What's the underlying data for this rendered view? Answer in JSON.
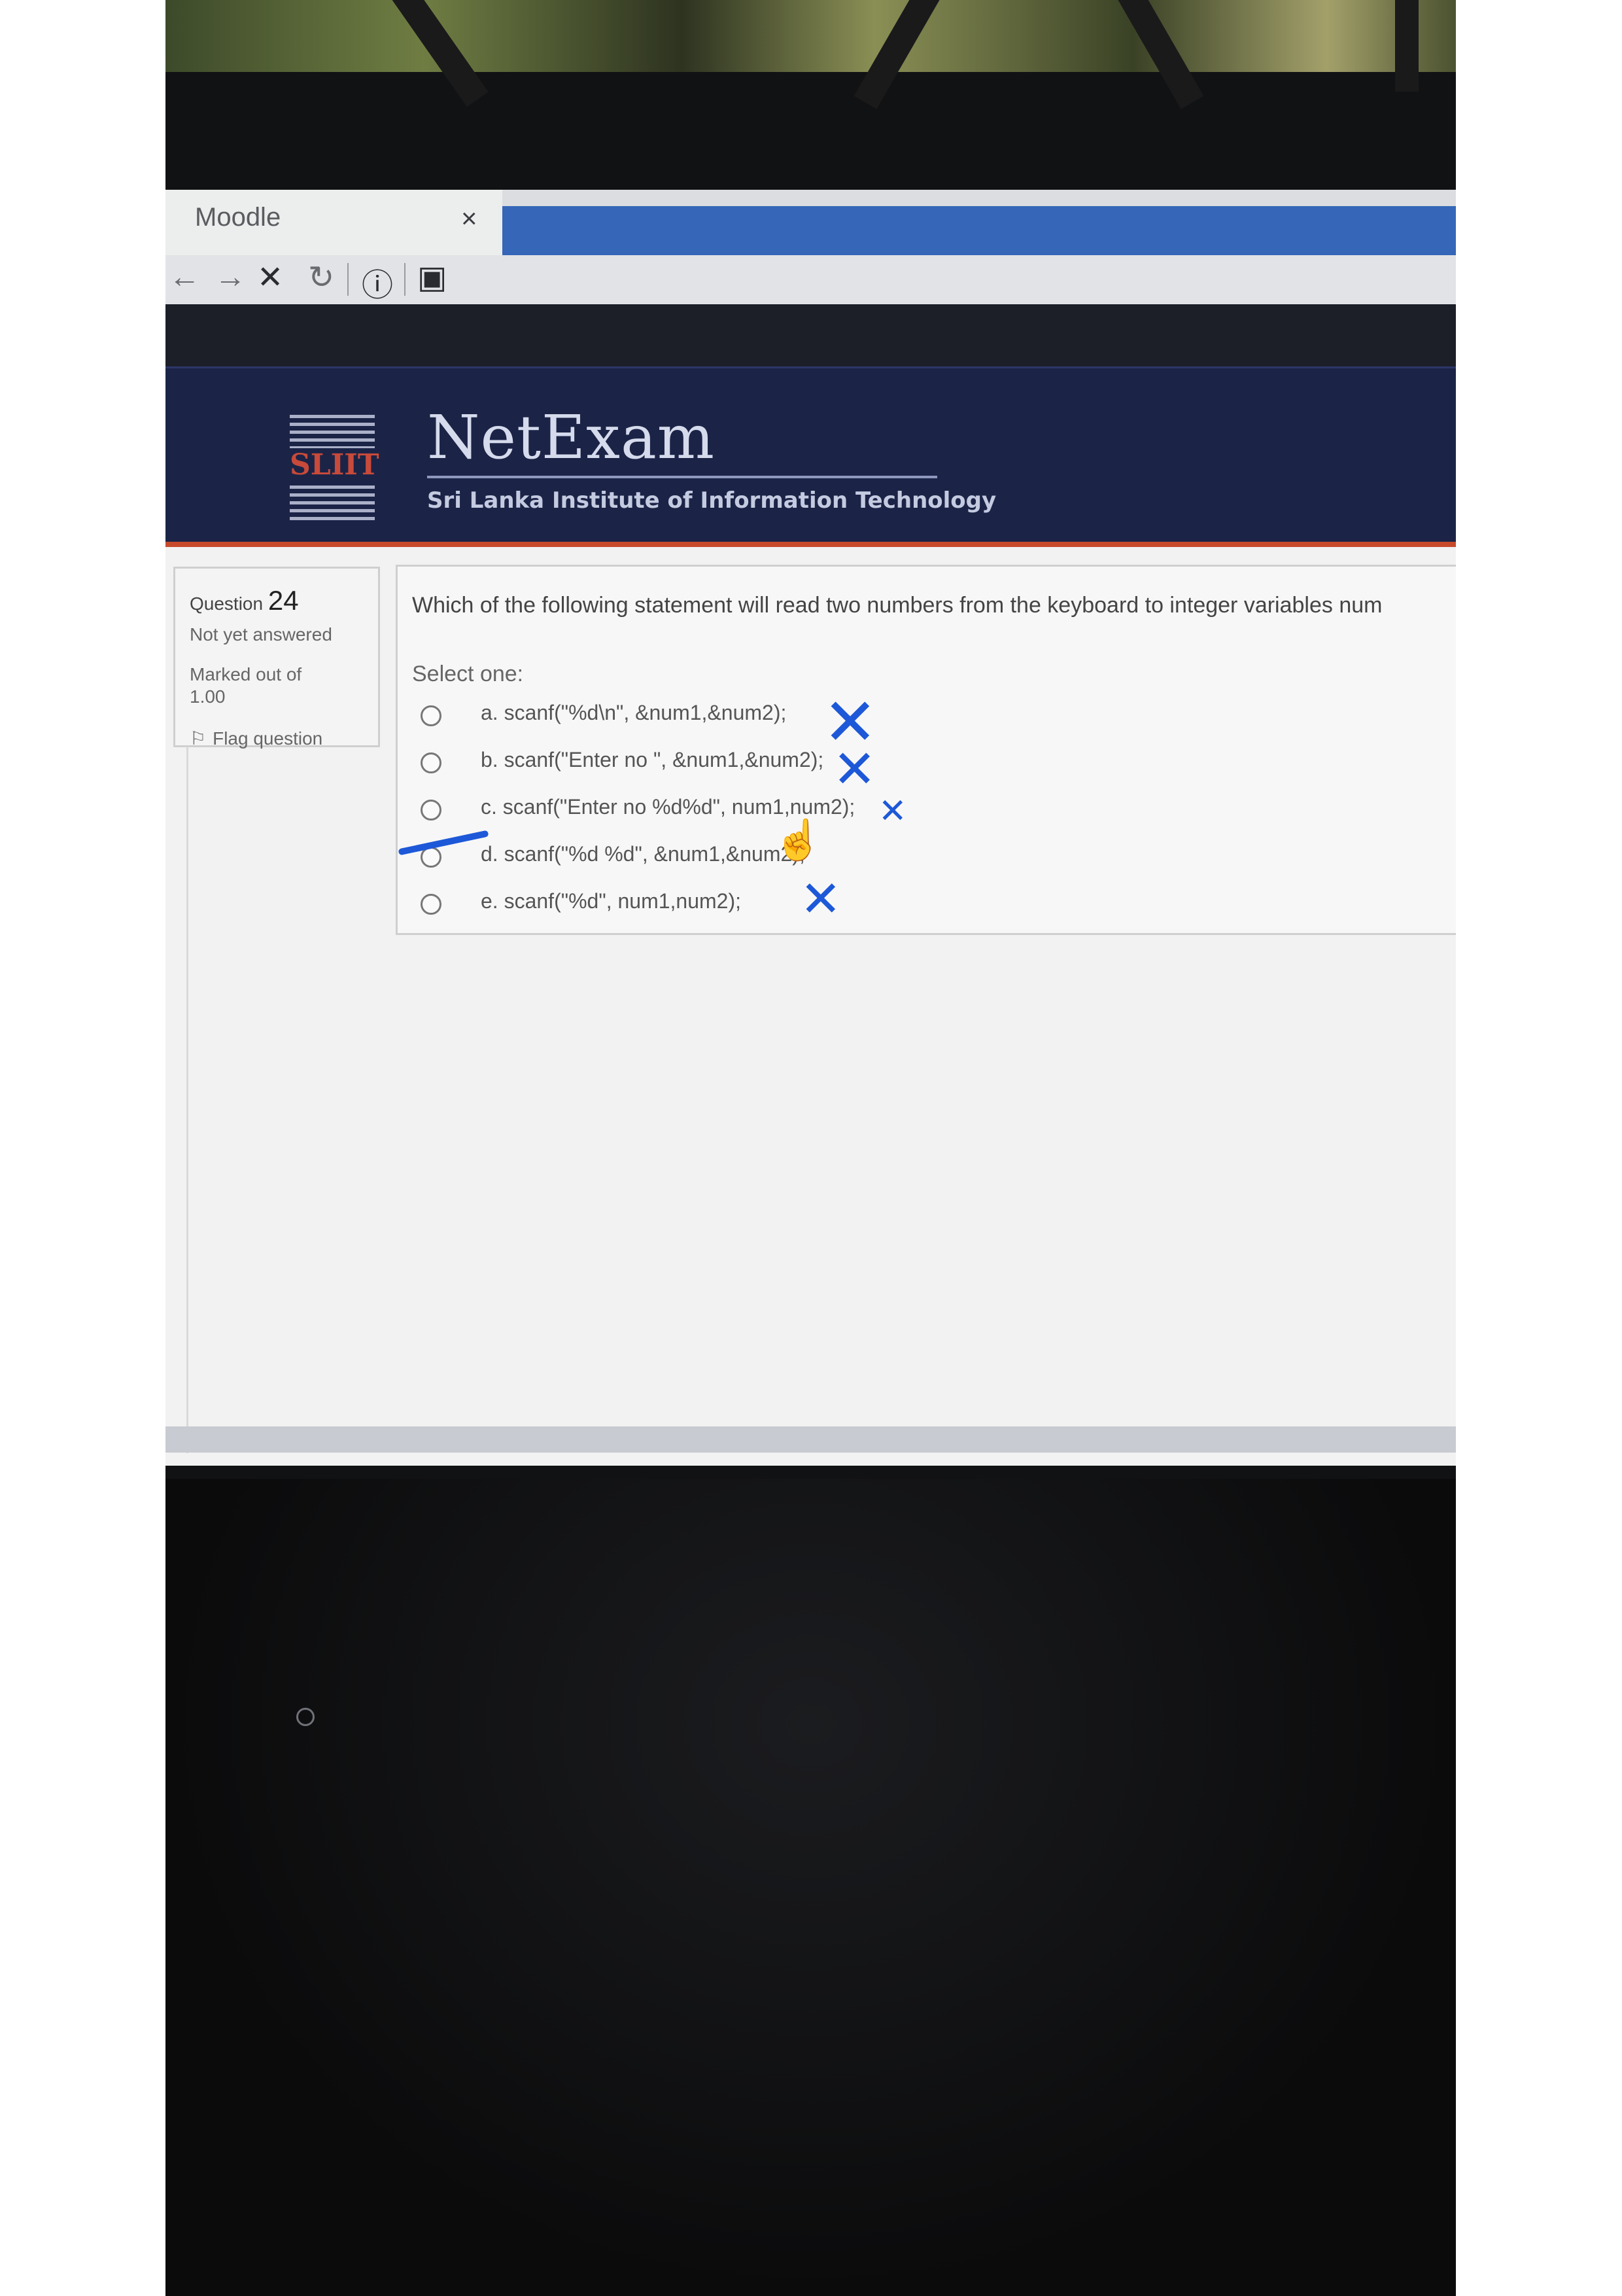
{
  "browser": {
    "tab_title": "Moodle",
    "tab_close": "×",
    "nav_icons": {
      "back": "back-arrow-icon",
      "forward": "forward-arrow-icon",
      "stop": "stop-icon",
      "reload": "reload-icon",
      "info": "info-icon",
      "page": "page-icon"
    }
  },
  "header": {
    "logo_text": "SLIIT",
    "brand": "NetExam",
    "subtitle": "Sri Lanka Institute of Information Technology"
  },
  "question_info": {
    "label": "Question",
    "number": "24",
    "status": "Not yet answered",
    "marked_out_of_label": "Marked out of",
    "marked_out_of_value": "1.00",
    "flag_label": "Flag question"
  },
  "question": {
    "text": "Which of the following statement will read two numbers from the keyboard to integer variables num",
    "select_label": "Select one:",
    "options": [
      {
        "letter": "a.",
        "text": "scanf(\"%d\\n\", &num1,&num2);"
      },
      {
        "letter": "b.",
        "text": "scanf(\"Enter no \", &num1,&num2);"
      },
      {
        "letter": "c.",
        "text": "scanf(\"Enter no %d%d\", num1,num2);"
      },
      {
        "letter": "d.",
        "text": "scanf(\"%d %d\", &num1,&num2);"
      },
      {
        "letter": "e.",
        "text": "scanf(\"%d\", num1,num2);"
      }
    ]
  },
  "annotations": {
    "cross": "✕",
    "color": "#1d58d8"
  }
}
